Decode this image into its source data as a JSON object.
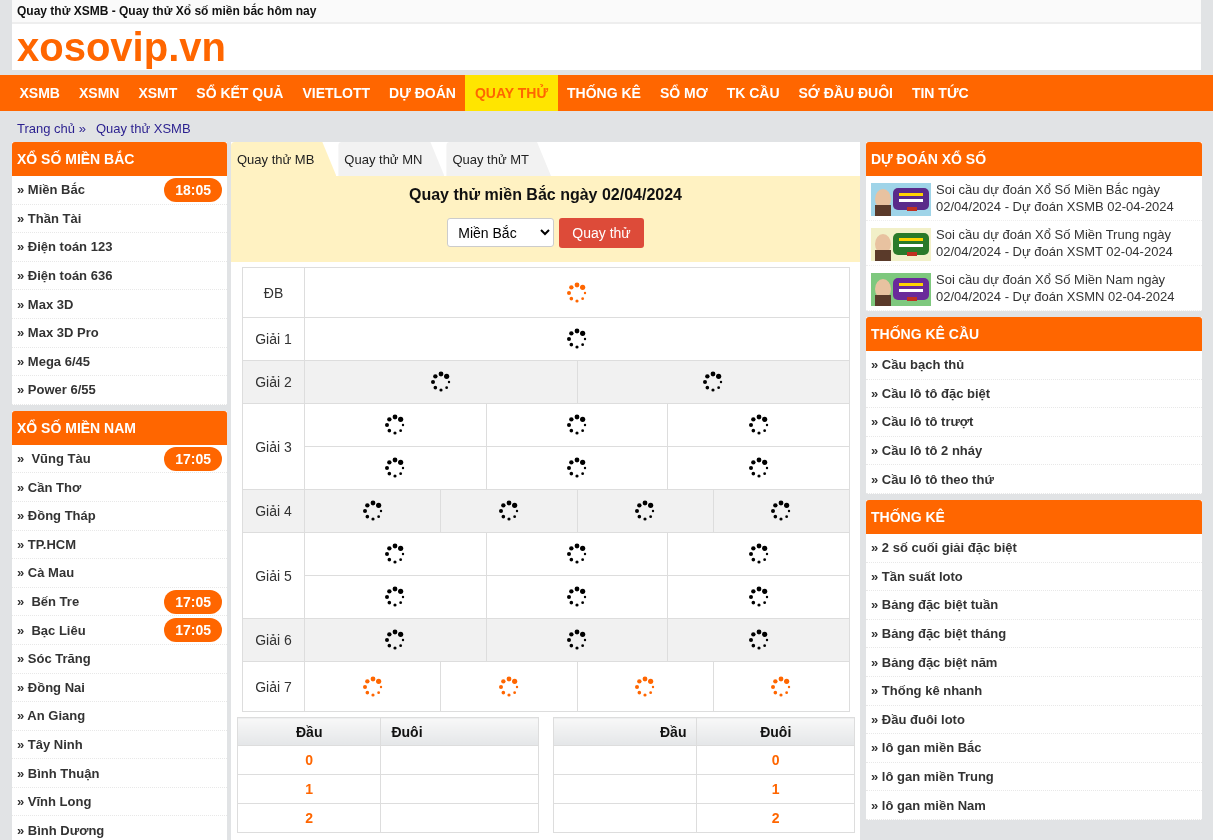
{
  "page_title": "Quay thử XSMB - Quay thử Xổ số miền bắc hôm nay",
  "logo": "xosovip.vn",
  "nav": [
    {
      "label": "XSMB",
      "selected": false
    },
    {
      "label": "XSMN",
      "selected": false
    },
    {
      "label": "XSMT",
      "selected": false
    },
    {
      "label": "SỔ KẾT QUẢ",
      "selected": false
    },
    {
      "label": "VIETLOTT",
      "selected": false
    },
    {
      "label": "DỰ ĐOÁN",
      "selected": false
    },
    {
      "label": "QUAY THỬ",
      "selected": true
    },
    {
      "label": "THỐNG KÊ",
      "selected": false
    },
    {
      "label": "SỔ MƠ",
      "selected": false
    },
    {
      "label": "TK CẦU",
      "selected": false
    },
    {
      "label": "SỚ ĐẦU ĐUÔI",
      "selected": false
    },
    {
      "label": "TIN TỨC",
      "selected": false
    }
  ],
  "breadcrumb": [
    "Trang chủ »",
    "Quay thử XSMB"
  ],
  "left_sidebar": [
    {
      "title": "XỔ SỐ MIỀN BẮC",
      "items": [
        {
          "label": "» Miền Bắc",
          "time": "18:05"
        },
        {
          "label": "» Thần Tài"
        },
        {
          "label": "» Điện toán 123"
        },
        {
          "label": "» Điện toán 636"
        },
        {
          "label": "» Max 3D"
        },
        {
          "label": "» Max 3D Pro"
        },
        {
          "label": "» Mega 6/45"
        },
        {
          "label": "» Power 6/55"
        }
      ]
    },
    {
      "title": "XỔ SỐ MIỀN NAM",
      "items": [
        {
          "label": "»  Vũng Tàu",
          "time": "17:05"
        },
        {
          "label": "» Cần Thơ"
        },
        {
          "label": "» Đồng Tháp"
        },
        {
          "label": "» TP.HCM"
        },
        {
          "label": "» Cà Mau"
        },
        {
          "label": "»  Bến Tre",
          "time": "17:05"
        },
        {
          "label": "»  Bạc Liêu",
          "time": "17:05"
        },
        {
          "label": "» Sóc Trăng"
        },
        {
          "label": "» Đồng Nai"
        },
        {
          "label": "» An Giang"
        },
        {
          "label": "» Tây Ninh"
        },
        {
          "label": "» Bình Thuận"
        },
        {
          "label": "» Vĩnh Long"
        },
        {
          "label": "» Bình Dương"
        }
      ]
    }
  ],
  "tabs": [
    {
      "label": "Quay thử MB",
      "selected": true
    },
    {
      "label": "Quay thử MN",
      "selected": false
    },
    {
      "label": "Quay thử MT",
      "selected": false
    }
  ],
  "panel": {
    "heading": "Quay thử miền Bắc ngày 02/04/2024",
    "region_select": "Miền Bắc",
    "spin_button": "Quay thử"
  },
  "prizes": [
    {
      "label": "ĐB",
      "color": "#ff6600",
      "lines": [
        [
          {
            "kind": "spinner"
          }
        ]
      ]
    },
    {
      "label": "Giải 1",
      "color": "#000000",
      "lines": [
        [
          {
            "kind": "spinner"
          }
        ]
      ]
    },
    {
      "label": "Giải 2",
      "color": "#000000",
      "lines": [
        [
          {
            "kind": "spinner"
          },
          {
            "kind": "spinner"
          }
        ]
      ]
    },
    {
      "label": "Giải 3",
      "color": "#000000",
      "lines": [
        [
          {
            "kind": "spinner"
          },
          {
            "kind": "spinner"
          },
          {
            "kind": "spinner"
          }
        ],
        [
          {
            "kind": "spinner"
          },
          {
            "kind": "spinner"
          },
          {
            "kind": "spinner"
          }
        ]
      ]
    },
    {
      "label": "Giải 4",
      "color": "#000000",
      "lines": [
        [
          {
            "kind": "spinner"
          },
          {
            "kind": "spinner"
          },
          {
            "kind": "spinner"
          },
          {
            "kind": "spinner"
          }
        ]
      ]
    },
    {
      "label": "Giải 5",
      "color": "#000000",
      "lines": [
        [
          {
            "kind": "spinner"
          },
          {
            "kind": "spinner"
          },
          {
            "kind": "spinner"
          }
        ],
        [
          {
            "kind": "spinner"
          },
          {
            "kind": "spinner"
          },
          {
            "kind": "spinner"
          }
        ]
      ]
    },
    {
      "label": "Giải 6",
      "color": "#000000",
      "lines": [
        [
          {
            "kind": "spinner"
          },
          {
            "kind": "spinner"
          },
          {
            "kind": "spinner"
          }
        ]
      ]
    },
    {
      "label": "Giải 7",
      "color": "#ff6600",
      "lines": [
        [
          {
            "kind": "spinner"
          },
          {
            "kind": "spinner"
          },
          {
            "kind": "spinner"
          },
          {
            "kind": "spinner"
          }
        ]
      ]
    }
  ],
  "loto_tables": [
    {
      "columns": [
        "Đầu",
        "Đuôi"
      ],
      "rows": [
        [
          "0",
          ""
        ],
        [
          "1",
          ""
        ],
        [
          "2",
          ""
        ]
      ]
    },
    {
      "columns": [
        "Đầu",
        "Đuôi"
      ],
      "rows": [
        [
          "",
          "0"
        ],
        [
          "",
          "1"
        ],
        [
          "",
          "2"
        ]
      ]
    }
  ],
  "right_sidebar": [
    {
      "title": "DỰ ĐOÁN XỔ SỐ",
      "kind": "articles",
      "items": [
        {
          "label": "Soi cầu dự đoán Xổ Số Miền Bắc ngày 02/04/2024 - Dự đoán XSMB 02-04-2024",
          "kind": "picture"
        },
        {
          "label": "Soi cầu dự đoán Xổ Số Miền Trung ngày 02/04/2024 - Dự đoán XSMT 02-04-2024",
          "kind": "picture"
        },
        {
          "label": "Soi cầu dự đoán Xổ Số Miền Nam ngày 02/04/2024 - Dự đoán XSMN 02-04-2024",
          "kind": "picture"
        }
      ]
    },
    {
      "title": "THỐNG KÊ CẦU",
      "kind": "links",
      "items": [
        {
          "label": "» Cầu bạch thủ"
        },
        {
          "label": "» Cầu lô tô đặc biệt"
        },
        {
          "label": "» Cầu lô tô trượt"
        },
        {
          "label": "» Cầu lô tô 2 nháy"
        },
        {
          "label": "» Cầu lô tô theo thứ"
        }
      ]
    },
    {
      "title": "THỐNG KÊ",
      "kind": "links",
      "items": [
        {
          "label": "» 2 số cuối giải đặc biệt"
        },
        {
          "label": "» Tần suất loto"
        },
        {
          "label": "» Bảng đặc biệt tuần"
        },
        {
          "label": "» Bảng đặc biệt tháng"
        },
        {
          "label": "» Bảng đặc biệt năm"
        },
        {
          "label": "» Thống kê nhanh"
        },
        {
          "label": "» Đầu đuôi loto"
        },
        {
          "label": "» lô gan miền Bắc"
        },
        {
          "label": "» lô gan miền Trung"
        },
        {
          "label": "» lô gan miền Nam"
        }
      ]
    }
  ]
}
